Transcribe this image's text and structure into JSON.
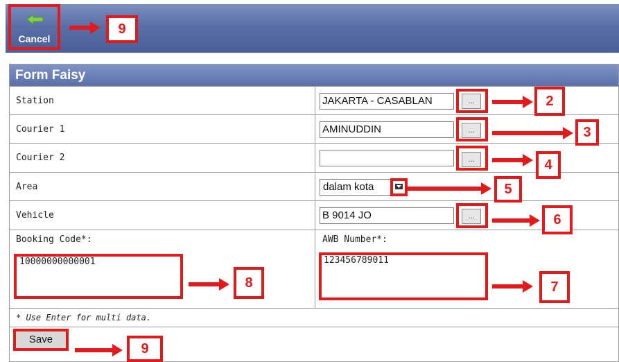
{
  "toolbar": {
    "cancel_label": "Cancel",
    "cancel_callout": "9"
  },
  "form": {
    "title": "Form Faisy",
    "station": {
      "label": "Station",
      "value": "JAKARTA - CASABLAN",
      "button": "...",
      "callout": "2"
    },
    "courier1": {
      "label": "Courier 1",
      "value": "AMINUDDIN",
      "button": "...",
      "callout": "3"
    },
    "courier2": {
      "label": "Courier 2",
      "value": "",
      "button": "...",
      "callout": "4"
    },
    "area": {
      "label": "Area",
      "value": "dalam kota",
      "callout": "5"
    },
    "vehicle": {
      "label": "Vehicle",
      "value": "B 9014 JO",
      "button": "...",
      "callout": "6"
    },
    "booking": {
      "label": "Booking Code*:",
      "value": "10000000000001",
      "callout": "8"
    },
    "awb": {
      "label": "AWB Number*:",
      "value": "123456789011",
      "callout": "7"
    },
    "note": "* Use Enter for multi data.",
    "save_label": "Save",
    "save_callout": "9"
  },
  "colors": {
    "header_blue": "#5b70a8",
    "callout_red": "#e11b1b"
  }
}
